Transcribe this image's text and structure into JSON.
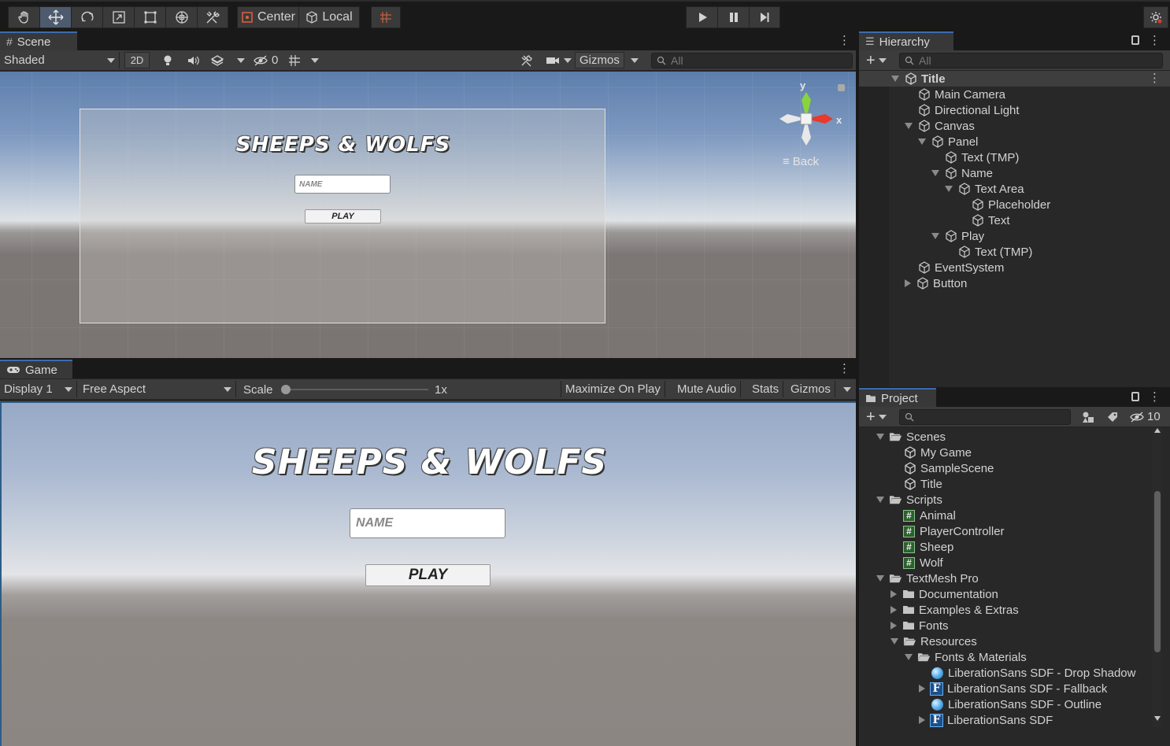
{
  "toolbar": {
    "pivot_label": "Center",
    "space_label": "Local",
    "tools": [
      "hand-tool",
      "move-tool",
      "rotate-tool",
      "scale-tool",
      "rect-tool",
      "transform-tool",
      "custom-editor-tool"
    ]
  },
  "scene": {
    "tab_label": "Scene",
    "shading_mode": "Shaded",
    "mode_2d_label": "2D",
    "hidden_count": "0",
    "gizmos_label": "Gizmos",
    "search_placeholder": "All",
    "gizmo_y_label": "y",
    "gizmo_x_label": "x",
    "view_label": "Back"
  },
  "game_ui": {
    "title": "SHEEPS & WOLFS",
    "name_placeholder": "NAME",
    "play_label": "PLAY"
  },
  "game": {
    "tab_label": "Game",
    "display_label": "Display 1",
    "aspect_label": "Free Aspect",
    "scale_label": "Scale",
    "scale_value": "1x",
    "maximize_label": "Maximize On Play",
    "mute_label": "Mute Audio",
    "stats_label": "Stats",
    "gizmos_label": "Gizmos"
  },
  "hierarchy": {
    "tab_label": "Hierarchy",
    "search_placeholder": "All",
    "scene_name": "Title",
    "items": [
      {
        "label": "Main Camera",
        "depth": 1,
        "arrow": "none"
      },
      {
        "label": "Directional Light",
        "depth": 1,
        "arrow": "none"
      },
      {
        "label": "Canvas",
        "depth": 1,
        "arrow": "down"
      },
      {
        "label": "Panel",
        "depth": 2,
        "arrow": "down"
      },
      {
        "label": "Text (TMP)",
        "depth": 3,
        "arrow": "none"
      },
      {
        "label": "Name",
        "depth": 3,
        "arrow": "down"
      },
      {
        "label": "Text Area",
        "depth": 4,
        "arrow": "down"
      },
      {
        "label": "Placeholder",
        "depth": 5,
        "arrow": "none"
      },
      {
        "label": "Text",
        "depth": 5,
        "arrow": "none"
      },
      {
        "label": "Play",
        "depth": 3,
        "arrow": "down"
      },
      {
        "label": "Text (TMP)",
        "depth": 4,
        "arrow": "none"
      },
      {
        "label": "EventSystem",
        "depth": 1,
        "arrow": "none"
      },
      {
        "label": "Button",
        "depth": 1,
        "arrow": "right"
      }
    ]
  },
  "project": {
    "tab_label": "Project",
    "hidden_count": "10",
    "items": [
      {
        "label": "Scenes",
        "depth": 0,
        "arrow": "down",
        "icon": "folder-open"
      },
      {
        "label": "My Game",
        "depth": 1,
        "arrow": "none",
        "icon": "scene"
      },
      {
        "label": "SampleScene",
        "depth": 1,
        "arrow": "none",
        "icon": "scene"
      },
      {
        "label": "Title",
        "depth": 1,
        "arrow": "none",
        "icon": "scene"
      },
      {
        "label": "Scripts",
        "depth": 0,
        "arrow": "down",
        "icon": "folder-open"
      },
      {
        "label": "Animal",
        "depth": 1,
        "arrow": "none",
        "icon": "script"
      },
      {
        "label": "PlayerController",
        "depth": 1,
        "arrow": "none",
        "icon": "script"
      },
      {
        "label": "Sheep",
        "depth": 1,
        "arrow": "none",
        "icon": "script"
      },
      {
        "label": "Wolf",
        "depth": 1,
        "arrow": "none",
        "icon": "script"
      },
      {
        "label": "TextMesh Pro",
        "depth": 0,
        "arrow": "down",
        "icon": "folder-open"
      },
      {
        "label": "Documentation",
        "depth": 1,
        "arrow": "right",
        "icon": "folder"
      },
      {
        "label": "Examples & Extras",
        "depth": 1,
        "arrow": "right",
        "icon": "folder"
      },
      {
        "label": "Fonts",
        "depth": 1,
        "arrow": "right",
        "icon": "folder"
      },
      {
        "label": "Resources",
        "depth": 1,
        "arrow": "down",
        "icon": "folder-open"
      },
      {
        "label": "Fonts & Materials",
        "depth": 2,
        "arrow": "down",
        "icon": "folder-open"
      },
      {
        "label": "LiberationSans SDF - Drop Shadow",
        "depth": 3,
        "arrow": "none",
        "icon": "material"
      },
      {
        "label": "LiberationSans SDF - Fallback",
        "depth": 3,
        "arrow": "right",
        "icon": "font"
      },
      {
        "label": "LiberationSans SDF - Outline",
        "depth": 3,
        "arrow": "none",
        "icon": "material"
      },
      {
        "label": "LiberationSans SDF",
        "depth": 3,
        "arrow": "right",
        "icon": "font"
      }
    ]
  }
}
